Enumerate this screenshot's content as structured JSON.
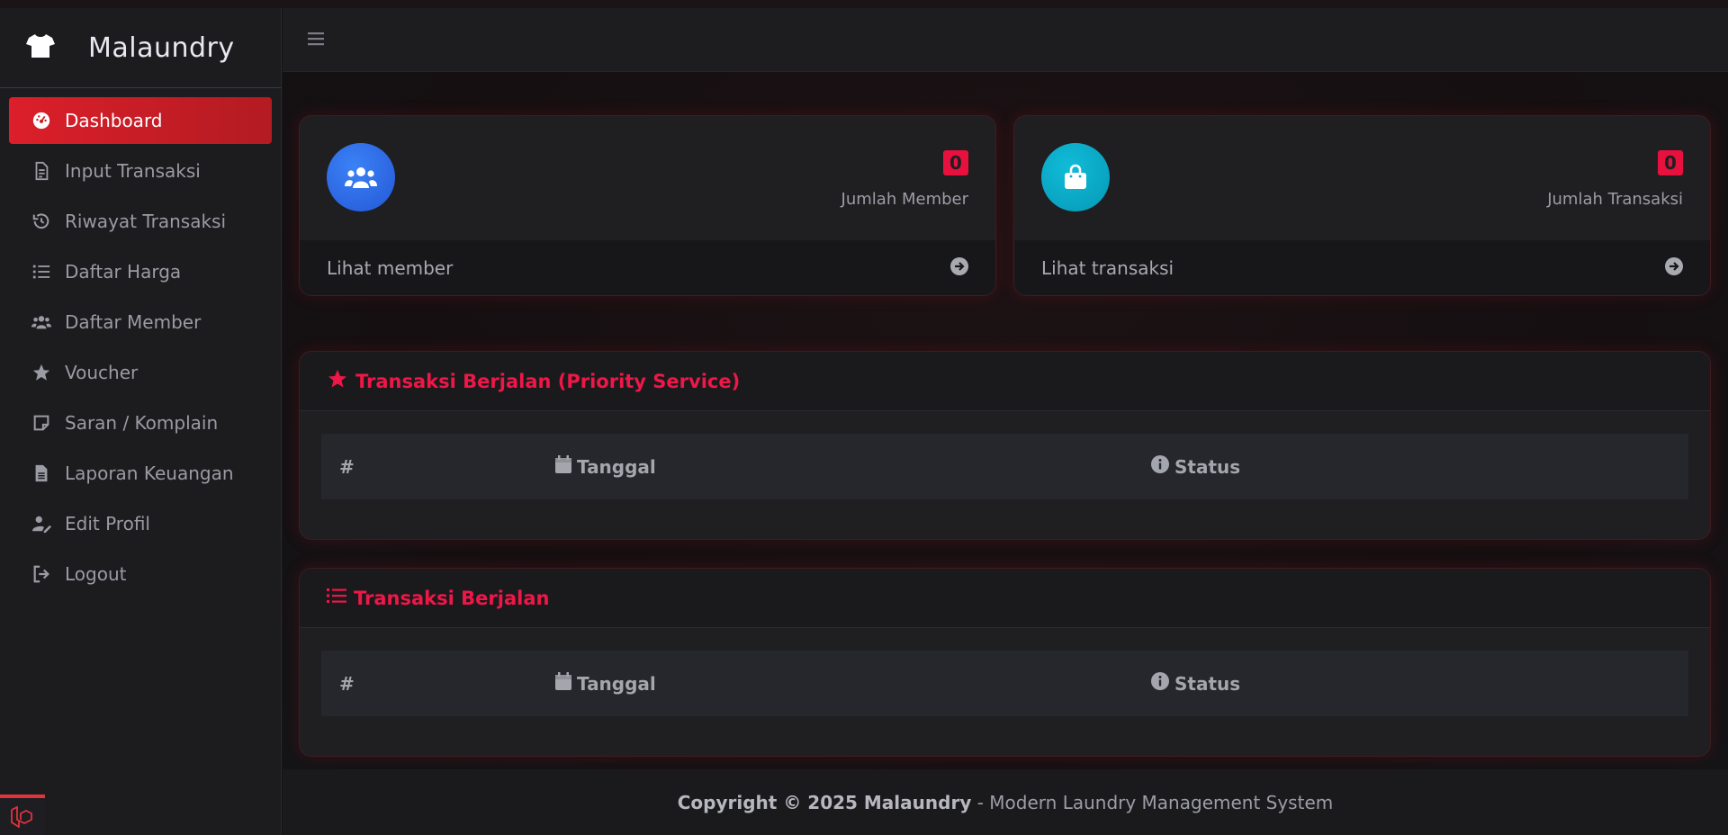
{
  "app": {
    "name": "Malaundry"
  },
  "sidebar": {
    "items": [
      {
        "label": "Dashboard",
        "icon": "gauge-icon",
        "active": true
      },
      {
        "label": "Input Transaksi",
        "icon": "file-invoice-icon"
      },
      {
        "label": "Riwayat Transaksi",
        "icon": "history-icon"
      },
      {
        "label": "Daftar Harga",
        "icon": "list-icon"
      },
      {
        "label": "Daftar Member",
        "icon": "users-icon"
      },
      {
        "label": "Voucher",
        "icon": "star-icon"
      },
      {
        "label": "Saran / Komplain",
        "icon": "note-icon"
      },
      {
        "label": "Laporan Keuangan",
        "icon": "file-text-icon"
      },
      {
        "label": "Edit Profil",
        "icon": "user-edit-icon"
      },
      {
        "label": "Logout",
        "icon": "sign-out-icon"
      }
    ]
  },
  "stats": {
    "member": {
      "value": "0",
      "label": "Jumlah Member",
      "link": "Lihat member",
      "color": "#2f6fe0"
    },
    "transaksi": {
      "value": "0",
      "label": "Jumlah Transaksi",
      "link": "Lihat transaksi",
      "color": "#0aa6c7"
    }
  },
  "priority_table": {
    "title": "Transaksi Berjalan (Priority Service)",
    "columns": [
      "#",
      "Tanggal",
      "Status"
    ]
  },
  "running_table": {
    "title": "Transaksi Berjalan",
    "columns": [
      "#",
      "Tanggal",
      "Status"
    ]
  },
  "footer": {
    "copyright": "Copyright © 2025 Malaundry",
    "tagline": " - Modern Laundry Management System"
  },
  "colors": {
    "accent": "#dc1f2a",
    "title_red": "#ee1747"
  }
}
